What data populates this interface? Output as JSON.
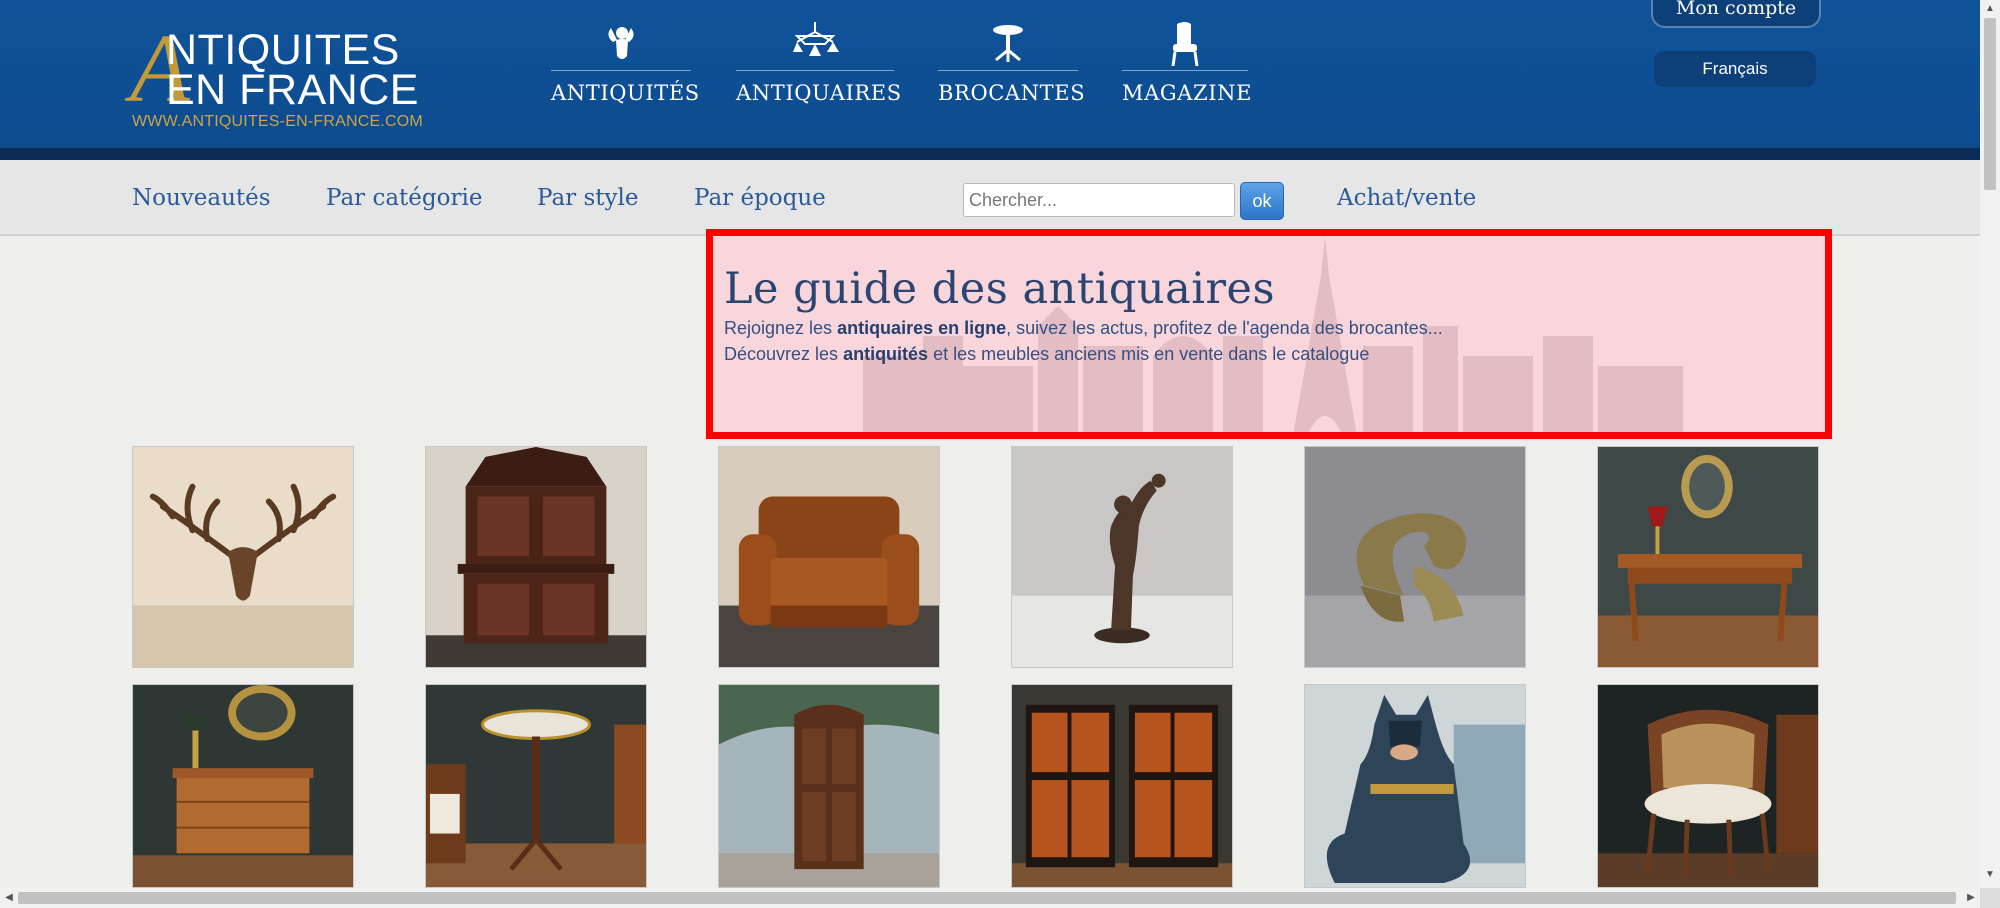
{
  "header": {
    "logo": {
      "line1": "NTIQUITES",
      "line2": "EN FRANCE",
      "letter": "A",
      "url": "WWW.ANTIQUITES-EN-FRANCE.COM"
    },
    "nav": [
      {
        "label": "ANTIQUITÉS",
        "icon": "cherub-icon"
      },
      {
        "label": "ANTIQUAIRES",
        "icon": "chandelier-icon"
      },
      {
        "label": "BROCANTES",
        "icon": "gueridon-icon"
      },
      {
        "label": "MAGAZINE",
        "icon": "armchair-icon"
      }
    ],
    "account": "Mon compte",
    "language": "Français"
  },
  "subnav": {
    "links": [
      "Nouveautés",
      "Par catégorie",
      "Par style",
      "Par époque"
    ],
    "search_placeholder": "Chercher...",
    "search_button": "ok",
    "buy_sell": "Achat/vente"
  },
  "guide": {
    "title": "Le guide des antiquaires",
    "line1": {
      "pre": "Rejoignez les ",
      "bold": "antiquaires en ligne",
      "post": ", suivez les actus, profitez de l'agenda des brocantes..."
    },
    "line2": {
      "pre": "Découvrez les ",
      "bold": "antiquités",
      "post": " et les meubles anciens mis en vente dans le catalogue"
    }
  },
  "products": [
    {
      "name": "antler-trophy"
    },
    {
      "name": "carved-dresser"
    },
    {
      "name": "leather-sofa"
    },
    {
      "name": "bronze-statue"
    },
    {
      "name": "bronze-ornament"
    },
    {
      "name": "writing-desk"
    },
    {
      "name": "chest-of-drawers"
    },
    {
      "name": "gueridon-table"
    },
    {
      "name": "wooden-armoire"
    },
    {
      "name": "lacquered-cabinets"
    },
    {
      "name": "batman-statue"
    },
    {
      "name": "cane-armchair"
    }
  ],
  "colors": {
    "header_blue": "#10539a",
    "gold": "#c39a3a",
    "link_blue": "#2a5a9a",
    "highlight_red": "#ff0000"
  }
}
